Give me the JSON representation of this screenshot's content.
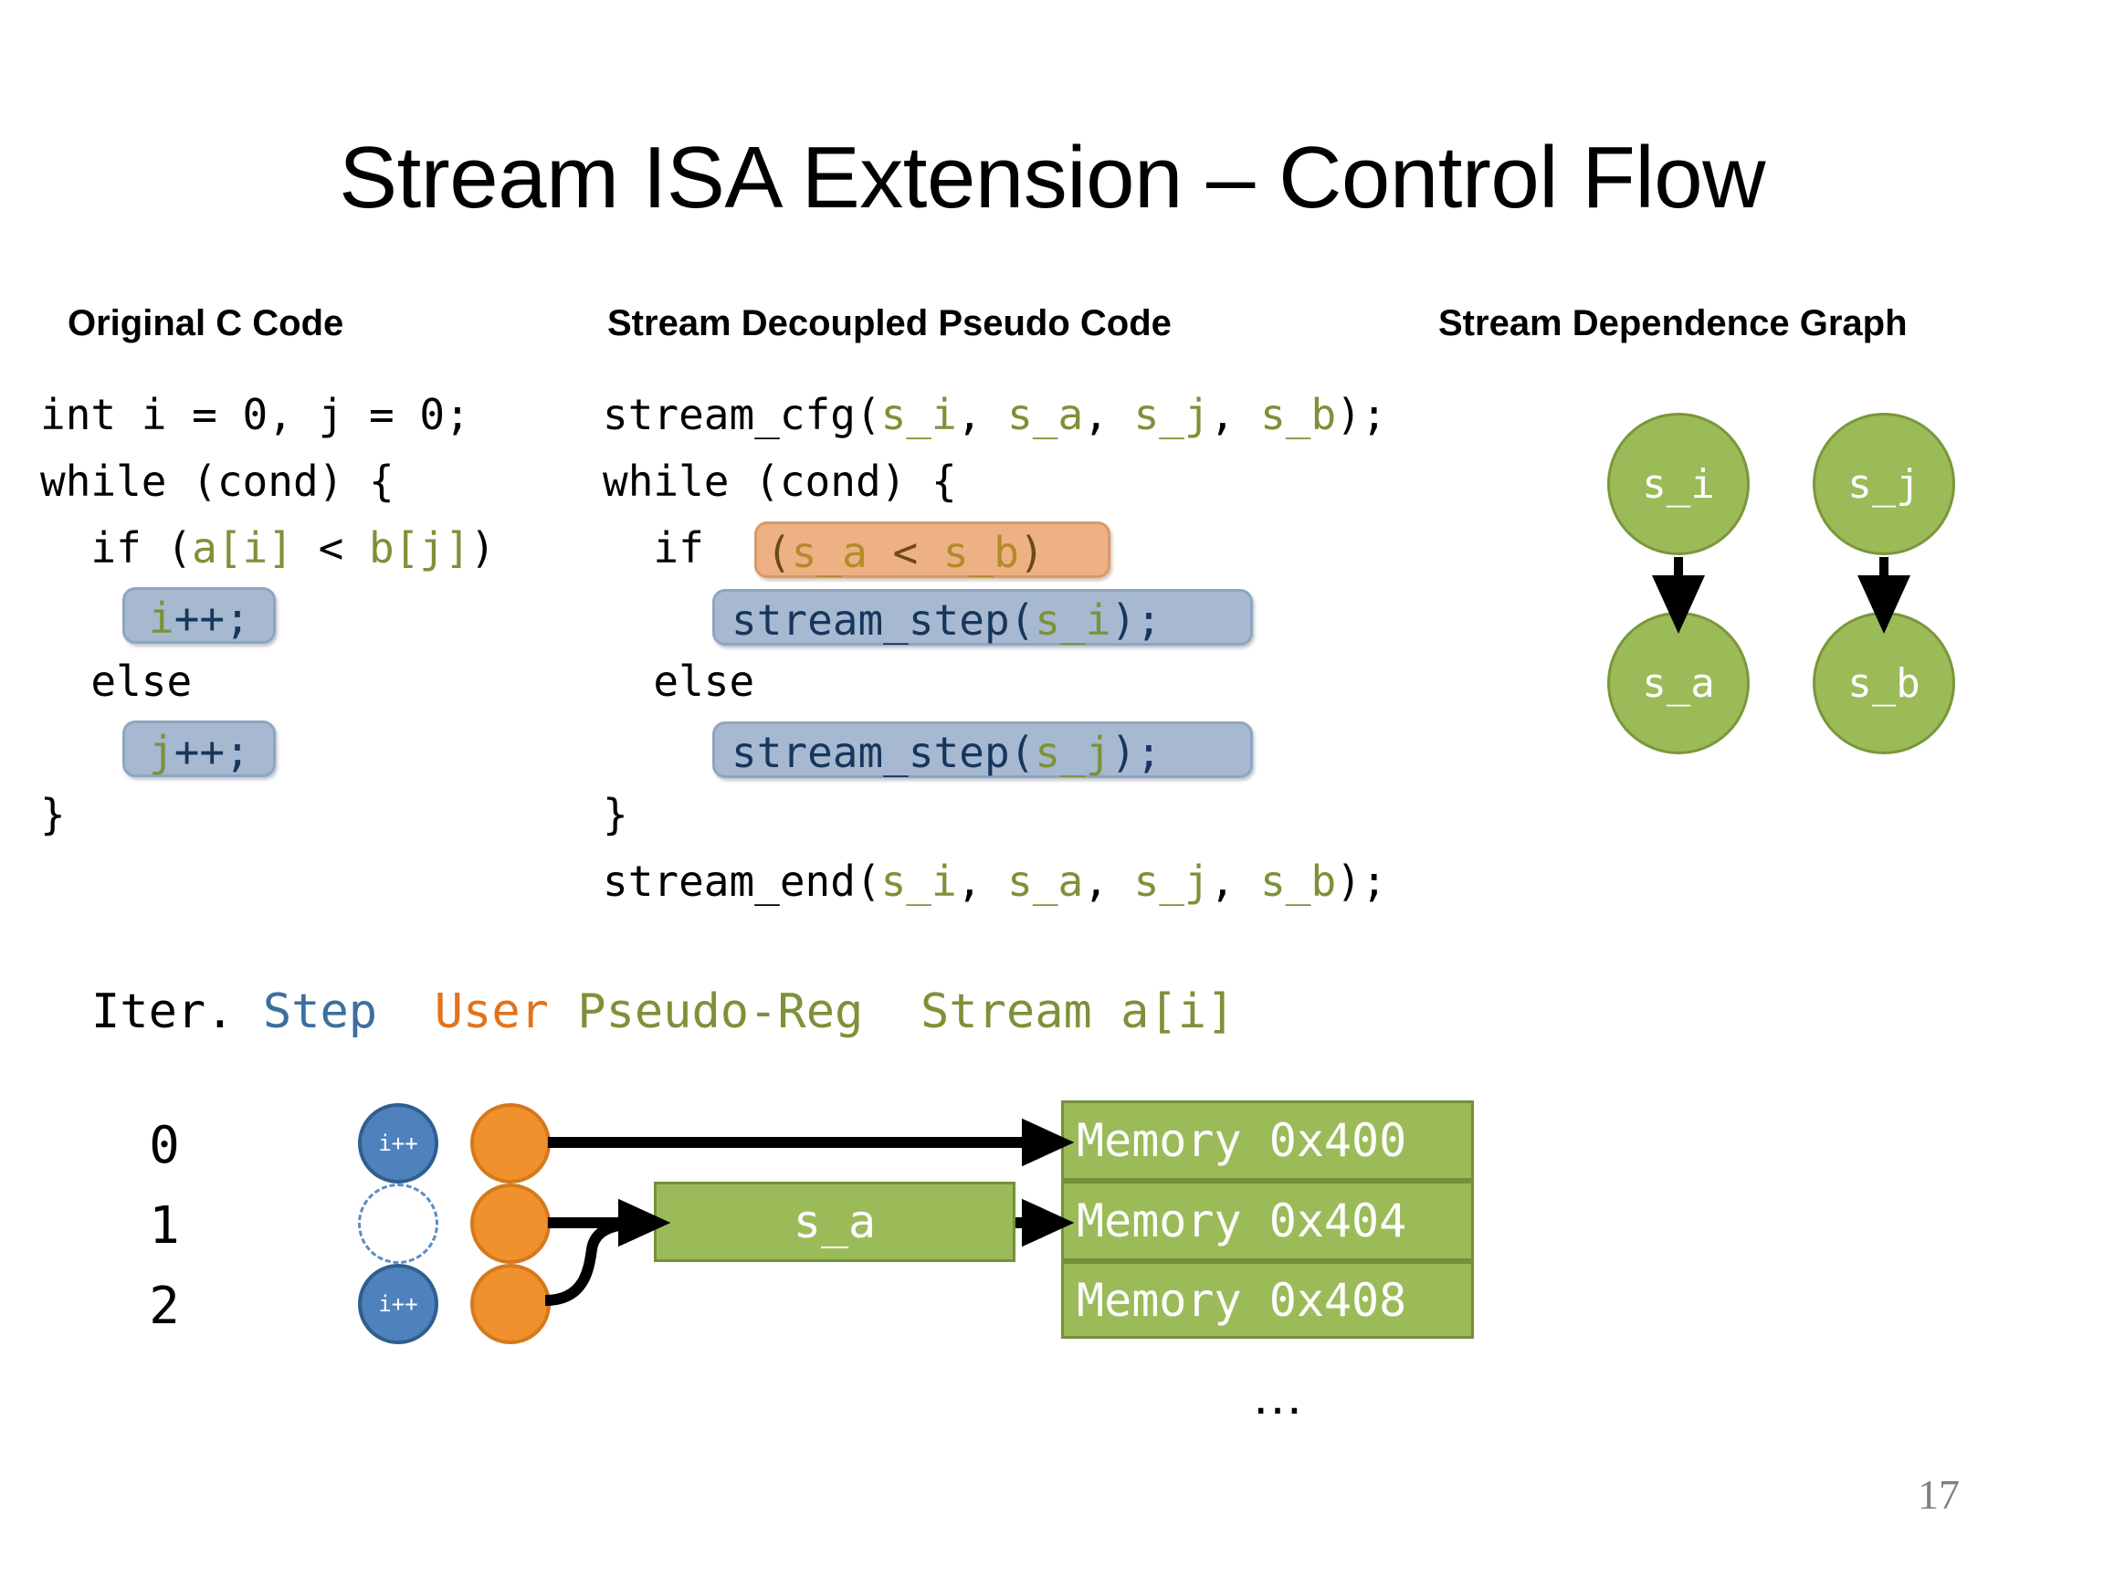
{
  "slide": {
    "title": "Stream ISA Extension – Control Flow",
    "page_number": "17"
  },
  "headers": {
    "c_code": "Original C Code",
    "pseudo_code": "Stream Decoupled Pseudo Code",
    "dep_graph": "Stream Dependence Graph"
  },
  "c_code": {
    "line1": "int i = 0, j = 0;",
    "line2": "while (cond) {",
    "line3_pre": "  if (",
    "line3_a": "a[i]",
    "line3_mid": " < ",
    "line3_b": "b[j]",
    "line3_post": ")",
    "chip_i": "i++;",
    "chip_i_var": "i",
    "chip_i_op": "++;",
    "line_else": "  else",
    "chip_j_var": "j",
    "chip_j_op": "++;",
    "chip_j": "j++;",
    "line_close": "}"
  },
  "pseudo_code": {
    "cfg_pre": "stream_cfg(",
    "cfg_args": [
      "s_i",
      "s_a",
      "s_j",
      "s_b"
    ],
    "cfg_post": ");",
    "while_line": "while (cond) {",
    "if_kw": "  if ",
    "cond_open": "(",
    "cond_left": "s_a",
    "cond_op": " < ",
    "cond_right": "s_b",
    "cond_close": ")",
    "step_i_pre": "stream_step(",
    "step_i_arg": "s_i",
    "step_i_post": ");",
    "else_line": "  else",
    "step_j_pre": "stream_step(",
    "step_j_arg": "s_j",
    "step_j_post": ");",
    "close_brace": "}",
    "end_pre": "stream_end(",
    "end_args": [
      "s_i",
      "s_a",
      "s_j",
      "s_b"
    ],
    "end_post": ");"
  },
  "dep_graph": {
    "nodes": [
      {
        "id": "s_i",
        "label": "s_i"
      },
      {
        "id": "s_j",
        "label": "s_j"
      },
      {
        "id": "s_a",
        "label": "s_a"
      },
      {
        "id": "s_b",
        "label": "s_b"
      }
    ],
    "edges": [
      {
        "from": "s_i",
        "to": "s_a"
      },
      {
        "from": "s_j",
        "to": "s_b"
      }
    ]
  },
  "timeline": {
    "legend": {
      "iter": "Iter.",
      "step": "Step",
      "user": "User",
      "pseudo_reg": "Pseudo-Reg",
      "stream": "Stream a[i]"
    },
    "rows": [
      {
        "iter": "0",
        "step_label": "i++",
        "step_active": true
      },
      {
        "iter": "1",
        "step_label": "",
        "step_active": false
      },
      {
        "iter": "2",
        "step_label": "i++",
        "step_active": true
      }
    ],
    "pseudo_reg_box": "s_a",
    "memory_boxes": [
      "Memory 0x400",
      "Memory 0x404",
      "Memory 0x408"
    ],
    "ellipsis": "…"
  },
  "colors": {
    "green": "#9bbb59",
    "green_border": "#7a9739",
    "blue": "#4f81bd",
    "orange": "#f0912d",
    "chip_blue": "#a6b9d0",
    "chip_orange": "#eeb183",
    "ident_green": "#7d9138",
    "legend_blue": "#3d6e9e",
    "legend_orange": "#e2721c",
    "page_gray": "#808080"
  }
}
